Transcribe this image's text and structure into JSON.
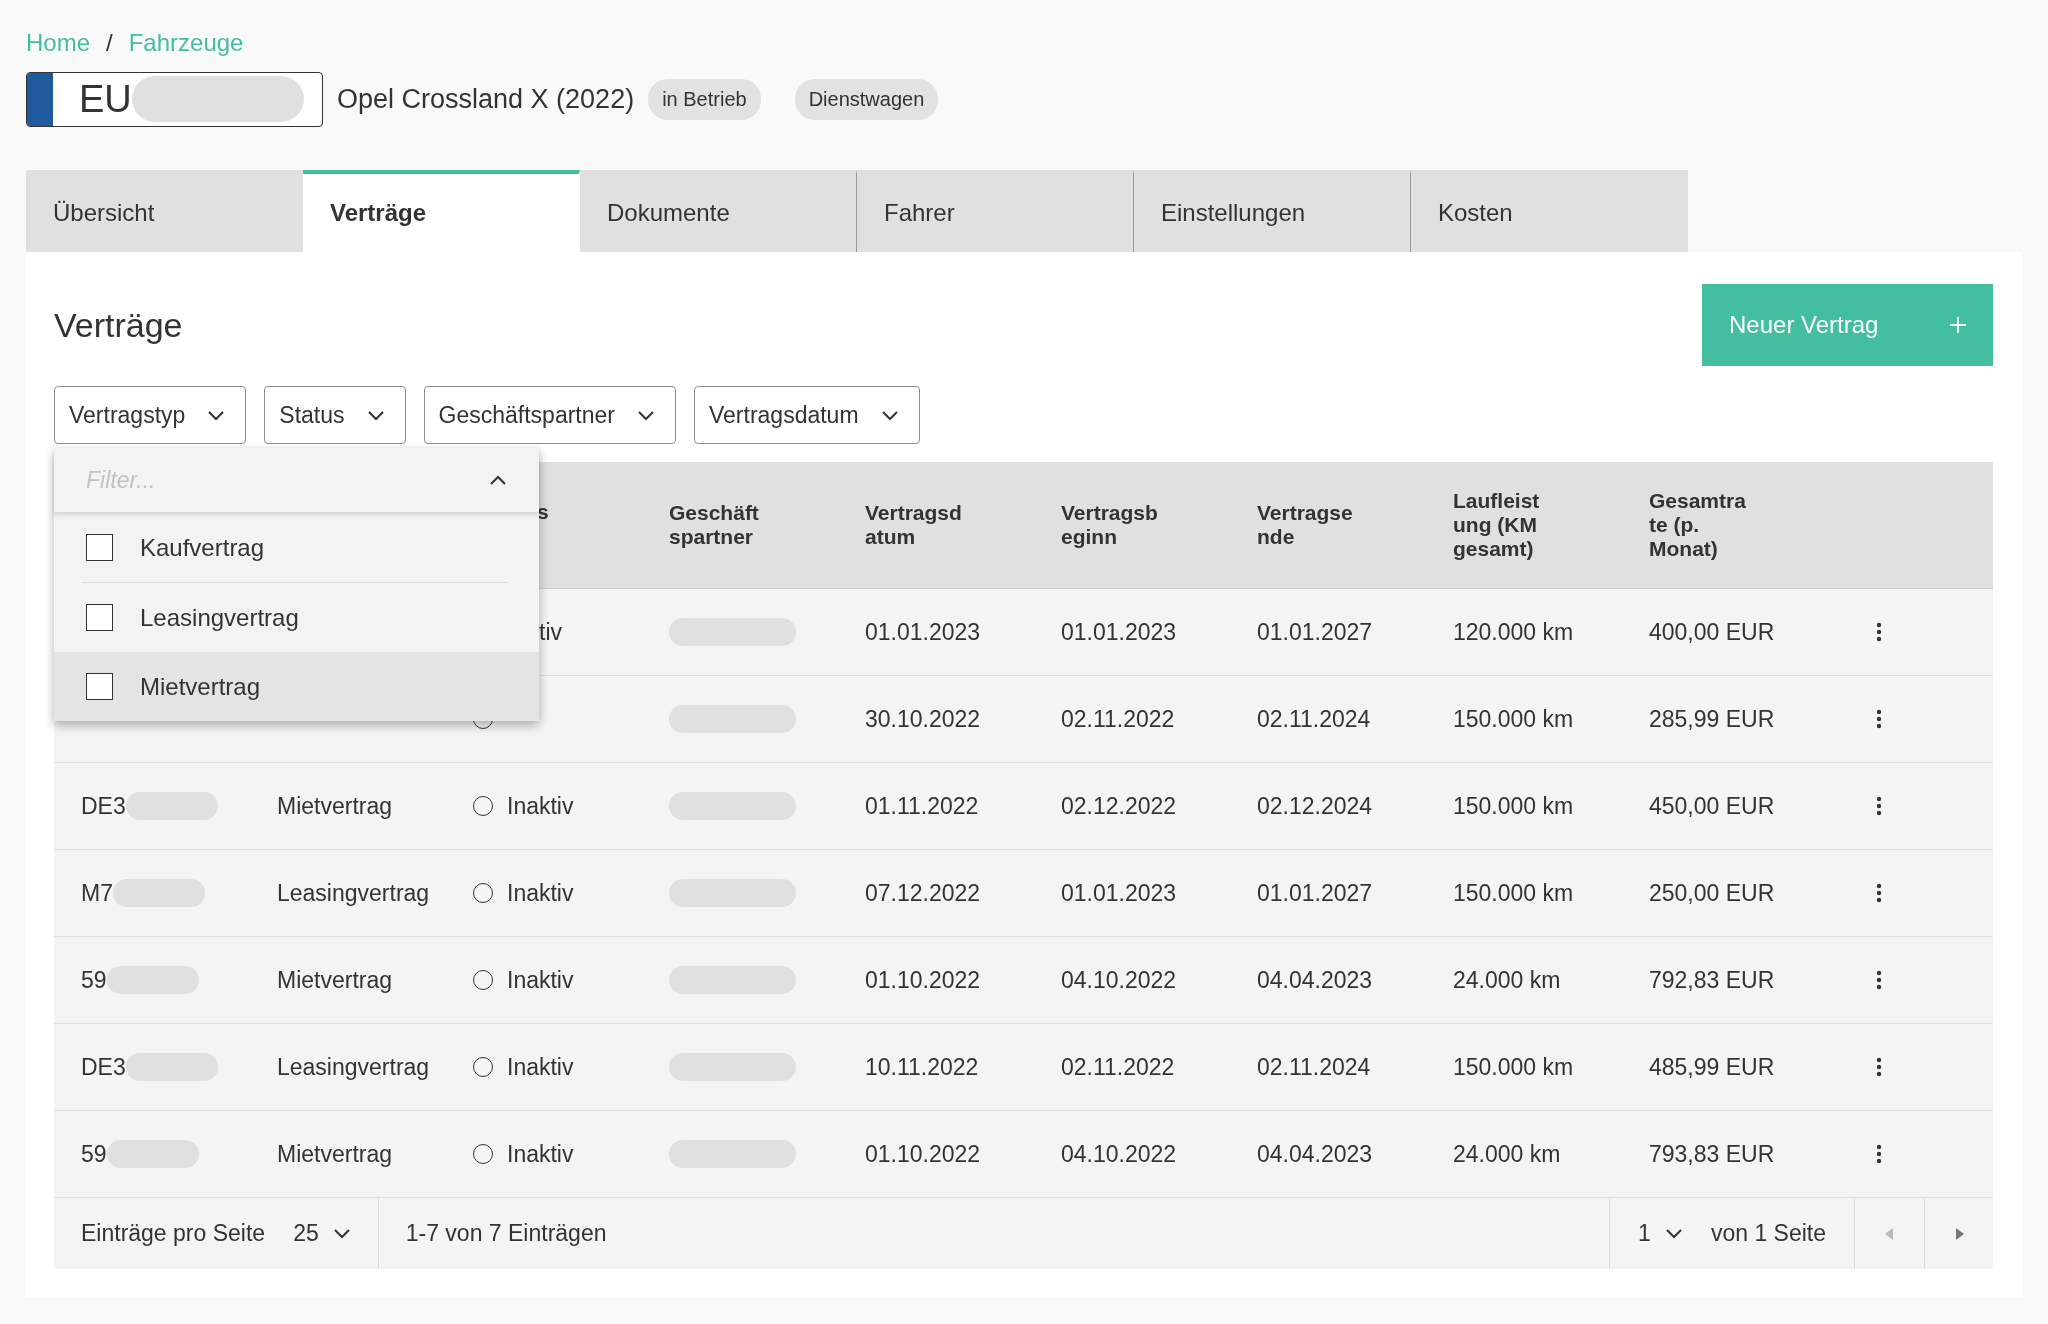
{
  "breadcrumb": {
    "items": [
      {
        "label": "Home"
      },
      {
        "label": "Fahrzeuge"
      }
    ],
    "separator": "/"
  },
  "vehicle": {
    "plate_prefix": "EU",
    "plate_redacted": true,
    "title": "Opel Crossland X (2022)",
    "badges": [
      "in Betrieb",
      "Dienstwagen"
    ]
  },
  "tabs": [
    {
      "label": "Übersicht",
      "selected": false
    },
    {
      "label": "Verträge",
      "selected": true
    },
    {
      "label": "Dokumente",
      "selected": false
    },
    {
      "label": "Fahrer",
      "selected": false
    },
    {
      "label": "Einstellungen",
      "selected": false
    },
    {
      "label": "Kosten",
      "selected": false
    }
  ],
  "panel": {
    "title": "Verträge",
    "new_button": "Neuer Vertrag"
  },
  "filters": [
    {
      "label": "Vertragstyp"
    },
    {
      "label": "Status"
    },
    {
      "label": "Geschäftspartner"
    },
    {
      "label": "Vertragsdatum"
    }
  ],
  "filter_dropdown": {
    "placeholder": "Filter...",
    "options": [
      {
        "label": "Kaufvertrag",
        "checked": false,
        "highlighted": false
      },
      {
        "label": "Leasingvertrag",
        "checked": false,
        "highlighted": false
      },
      {
        "label": "Mietvertrag",
        "checked": false,
        "highlighted": true
      }
    ]
  },
  "table": {
    "columns": [
      {},
      {},
      {
        "label": "s"
      },
      {
        "label": "Geschäftspartner"
      },
      {
        "label": "Vertragsdatum"
      },
      {
        "label": "Vertragsbeginn"
      },
      {
        "label": "Vertragsende"
      },
      {
        "label": "Laufleistung (KM gesamt)"
      },
      {
        "label": "Gesamtrate (p. Monat)"
      }
    ],
    "rows": [
      {
        "status": {
          "label": "tiv"
        },
        "partner_redacted": true,
        "date": "01.01.2023",
        "start": "01.01.2023",
        "end": "01.01.2027",
        "mileage": "120.000 km",
        "rate": "400,00 EUR"
      },
      {
        "status": {
          "active": false
        },
        "partner_redacted": true,
        "date": "30.10.2022",
        "start": "02.11.2022",
        "end": "02.11.2024",
        "mileage": "150.000 km",
        "rate": "285,99 EUR"
      },
      {
        "id": {
          "text": "DE3",
          "redacted": true
        },
        "type": "Mietvertrag",
        "status": {
          "label": "Inaktiv",
          "active": false
        },
        "partner_redacted": true,
        "date": "01.11.2022",
        "start": "02.12.2022",
        "end": "02.12.2024",
        "mileage": "150.000 km",
        "rate": "450,00 EUR"
      },
      {
        "id": {
          "text": "M7",
          "redacted": true
        },
        "type": "Leasingvertrag",
        "status": {
          "label": "Inaktiv",
          "active": false
        },
        "partner_redacted": true,
        "date": "07.12.2022",
        "start": "01.01.2023",
        "end": "01.01.2027",
        "mileage": "150.000 km",
        "rate": "250,00 EUR"
      },
      {
        "id": {
          "text": "59",
          "redacted": true
        },
        "type": "Mietvertrag",
        "status": {
          "label": "Inaktiv",
          "active": false
        },
        "partner_redacted": true,
        "date": "01.10.2022",
        "start": "04.10.2022",
        "end": "04.04.2023",
        "mileage": "24.000 km",
        "rate": "792,83 EUR"
      },
      {
        "id": {
          "text": "DE3",
          "redacted": true
        },
        "type": "Leasingvertrag",
        "status": {
          "label": "Inaktiv",
          "active": false
        },
        "partner_redacted": true,
        "date": "10.11.2022",
        "start": "02.11.2022",
        "end": "02.11.2024",
        "mileage": "150.000 km",
        "rate": "485,99 EUR"
      },
      {
        "id": {
          "text": "59",
          "redacted": true
        },
        "type": "Mietvertrag",
        "status": {
          "label": "Inaktiv",
          "active": false
        },
        "partner_redacted": true,
        "date": "01.10.2022",
        "start": "04.10.2022",
        "end": "04.04.2023",
        "mileage": "24.000 km",
        "rate": "793,83 EUR"
      }
    ]
  },
  "pager": {
    "page_size_label": "Einträge pro Seite",
    "page_size": "25",
    "range": "1-7 von 7 Einträgen",
    "page": "1",
    "page_total": "von 1 Seite",
    "prev_disabled": true,
    "next_disabled": false
  }
}
